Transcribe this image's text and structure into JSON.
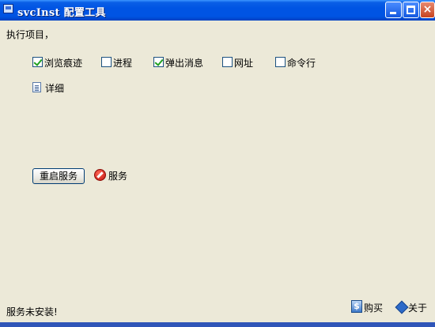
{
  "window": {
    "title": "svcInst 配置工具"
  },
  "main": {
    "heading": "执行项目，",
    "options": [
      {
        "label": "浏览痕迹",
        "checked": true
      },
      {
        "label": "进程",
        "checked": false
      },
      {
        "label": "弹出消息",
        "checked": true
      },
      {
        "label": "网址",
        "checked": false
      },
      {
        "label": "命令行",
        "checked": false
      }
    ],
    "detail_label": "详细",
    "restart_button": "重启服务",
    "service_label": "服务"
  },
  "footer": {
    "status": "服务未安装!",
    "buy_label": "购买",
    "buy_icon_glyph": "$",
    "about_label": "关于"
  },
  "icons": {
    "title": "app-window-icon",
    "detail": "document-list-icon",
    "service": "stop-icon",
    "buy": "dollar-icon",
    "about": "diamond-icon"
  },
  "colors": {
    "titlebar": "#0054e3",
    "window_bg": "#ece9d8",
    "check_mark": "#21a121"
  }
}
